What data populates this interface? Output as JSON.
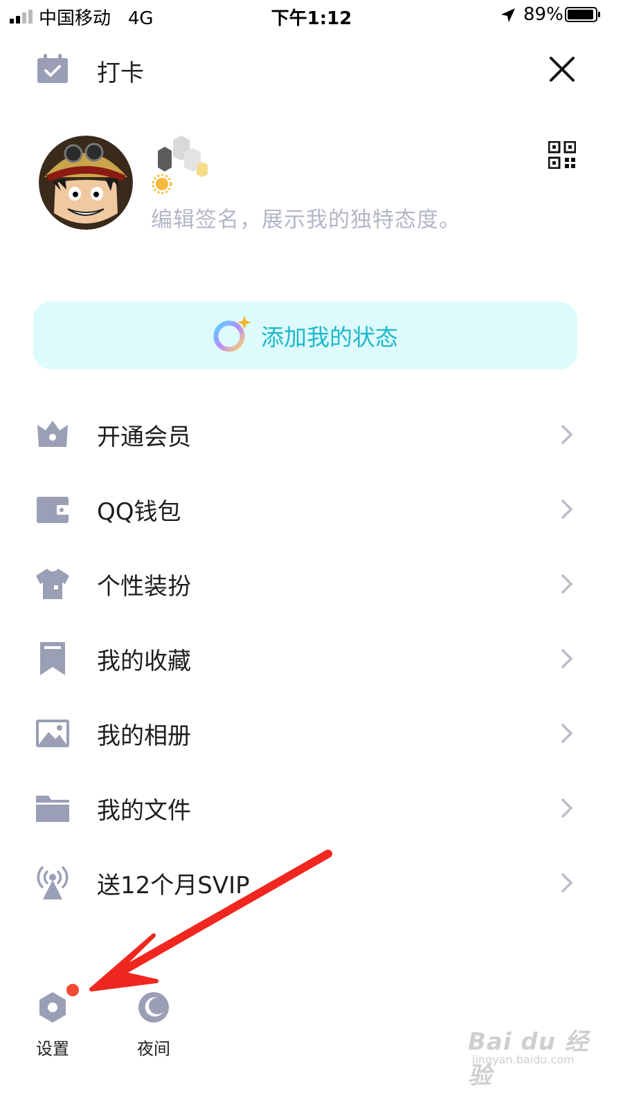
{
  "status_bar": {
    "carrier": "中国移动",
    "network": "4G",
    "time": "下午1:12",
    "battery": "89%"
  },
  "header": {
    "checkin_label": "打卡"
  },
  "profile": {
    "signature_placeholder": "编辑签名，展示我的独特态度。"
  },
  "status_button": {
    "label": "添加我的状态"
  },
  "menu": [
    {
      "label": "开通会员",
      "icon": "crown-icon"
    },
    {
      "label": "QQ钱包",
      "icon": "wallet-icon"
    },
    {
      "label": "个性装扮",
      "icon": "tshirt-icon"
    },
    {
      "label": "我的收藏",
      "icon": "bookmark-icon"
    },
    {
      "label": "我的相册",
      "icon": "image-icon"
    },
    {
      "label": "我的文件",
      "icon": "folder-icon"
    },
    {
      "label": "送12个月SVIP",
      "icon": "broadcast-icon"
    }
  ],
  "bottom": {
    "settings_label": "设置",
    "night_label": "夜间"
  },
  "watermark": {
    "main": "Bai du 经验",
    "sub": "jingyan.baidu.com"
  },
  "colors": {
    "icon_gray": "#9a9fb5",
    "accent_cyan": "#1fb8cc",
    "status_bg": "#ddfbfc",
    "annotation_red": "#f0271e",
    "badge_red": "#f24a35"
  }
}
